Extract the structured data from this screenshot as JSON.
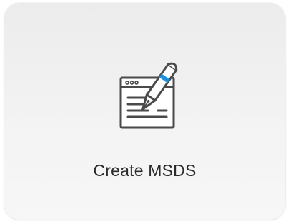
{
  "card": {
    "label": "Create MSDS",
    "icon": "document-pen-icon"
  },
  "colors": {
    "icon_stroke": "#4a4a4a",
    "accent": "#1e8fe0",
    "label": "#2b2b2b",
    "card_top": "#ececec",
    "card_bottom": "#f7f7f7"
  }
}
